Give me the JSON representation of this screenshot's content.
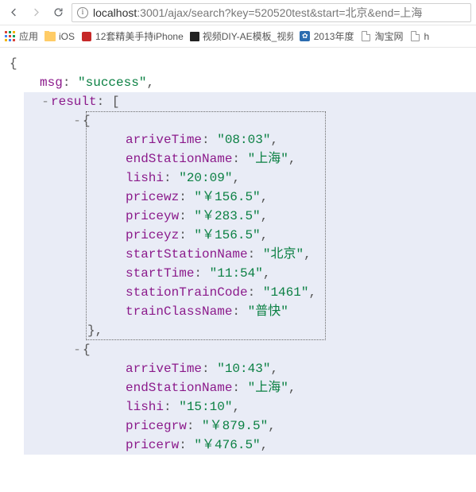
{
  "url": {
    "host": "localhost",
    "rest": ":3001/ajax/search?key=520520test&start=北京&end=上海"
  },
  "bookmarks": {
    "apps": "应用",
    "ios": "iOS",
    "iphone": "12套精美手持iPhone",
    "ae": "视频DIY-AE模板_视频",
    "y2013": "2013年度",
    "taobao": "淘宝网",
    "h": "h"
  },
  "json": {
    "brace_open": "{",
    "brace_close": "}",
    "bracket_open": "[",
    "bracket_close": "]",
    "comma": ",",
    "colon": ": ",
    "quote": "\"",
    "toggle": "-",
    "msg_key": "msg",
    "msg_val": "success",
    "result_key": "result",
    "items": [
      {
        "arriveTime": "08:03",
        "endStationName": "上海",
        "lishi": "20:09",
        "pricewz": "￥156.5",
        "priceyw": "￥283.5",
        "priceyz": "￥156.5",
        "startStationName": "北京",
        "startTime": "11:54",
        "stationTrainCode": "1461",
        "trainClassName": "普快"
      },
      {
        "arriveTime": "10:43",
        "endStationName": "上海",
        "lishi": "15:10",
        "pricegrw": "￥879.5",
        "pricerw": "￥476.5"
      }
    ],
    "keys": {
      "arriveTime": "arriveTime",
      "endStationName": "endStationName",
      "lishi": "lishi",
      "pricewz": "pricewz",
      "priceyw": "priceyw",
      "priceyz": "priceyz",
      "startStationName": "startStationName",
      "startTime": "startTime",
      "stationTrainCode": "stationTrainCode",
      "trainClassName": "trainClassName",
      "pricegrw": "pricegrw",
      "pricerw": "pricerw"
    }
  }
}
